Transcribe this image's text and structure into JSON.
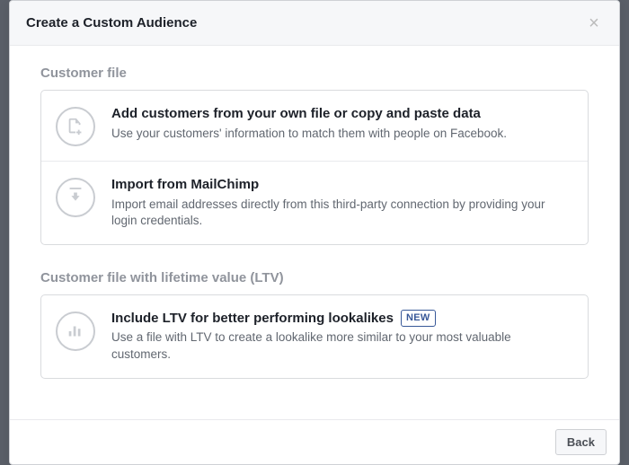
{
  "header": {
    "title": "Create a Custom Audience",
    "close_aria": "Close"
  },
  "sections": {
    "customer_file": {
      "label": "Customer file",
      "options": {
        "own_file": {
          "title": "Add customers from your own file or copy and paste data",
          "desc": "Use your customers' information to match them with people on Facebook."
        },
        "mailchimp": {
          "title": "Import from MailChimp",
          "desc": "Import email addresses directly from this third-party connection by providing your login credentials."
        }
      }
    },
    "ltv": {
      "label": "Customer file with lifetime value (LTV)",
      "options": {
        "ltv_lookalike": {
          "title": "Include LTV for better performing lookalikes",
          "badge": "NEW",
          "desc": "Use a file with LTV to create a lookalike more similar to your most valuable customers."
        }
      }
    }
  },
  "footer": {
    "back_label": "Back"
  }
}
